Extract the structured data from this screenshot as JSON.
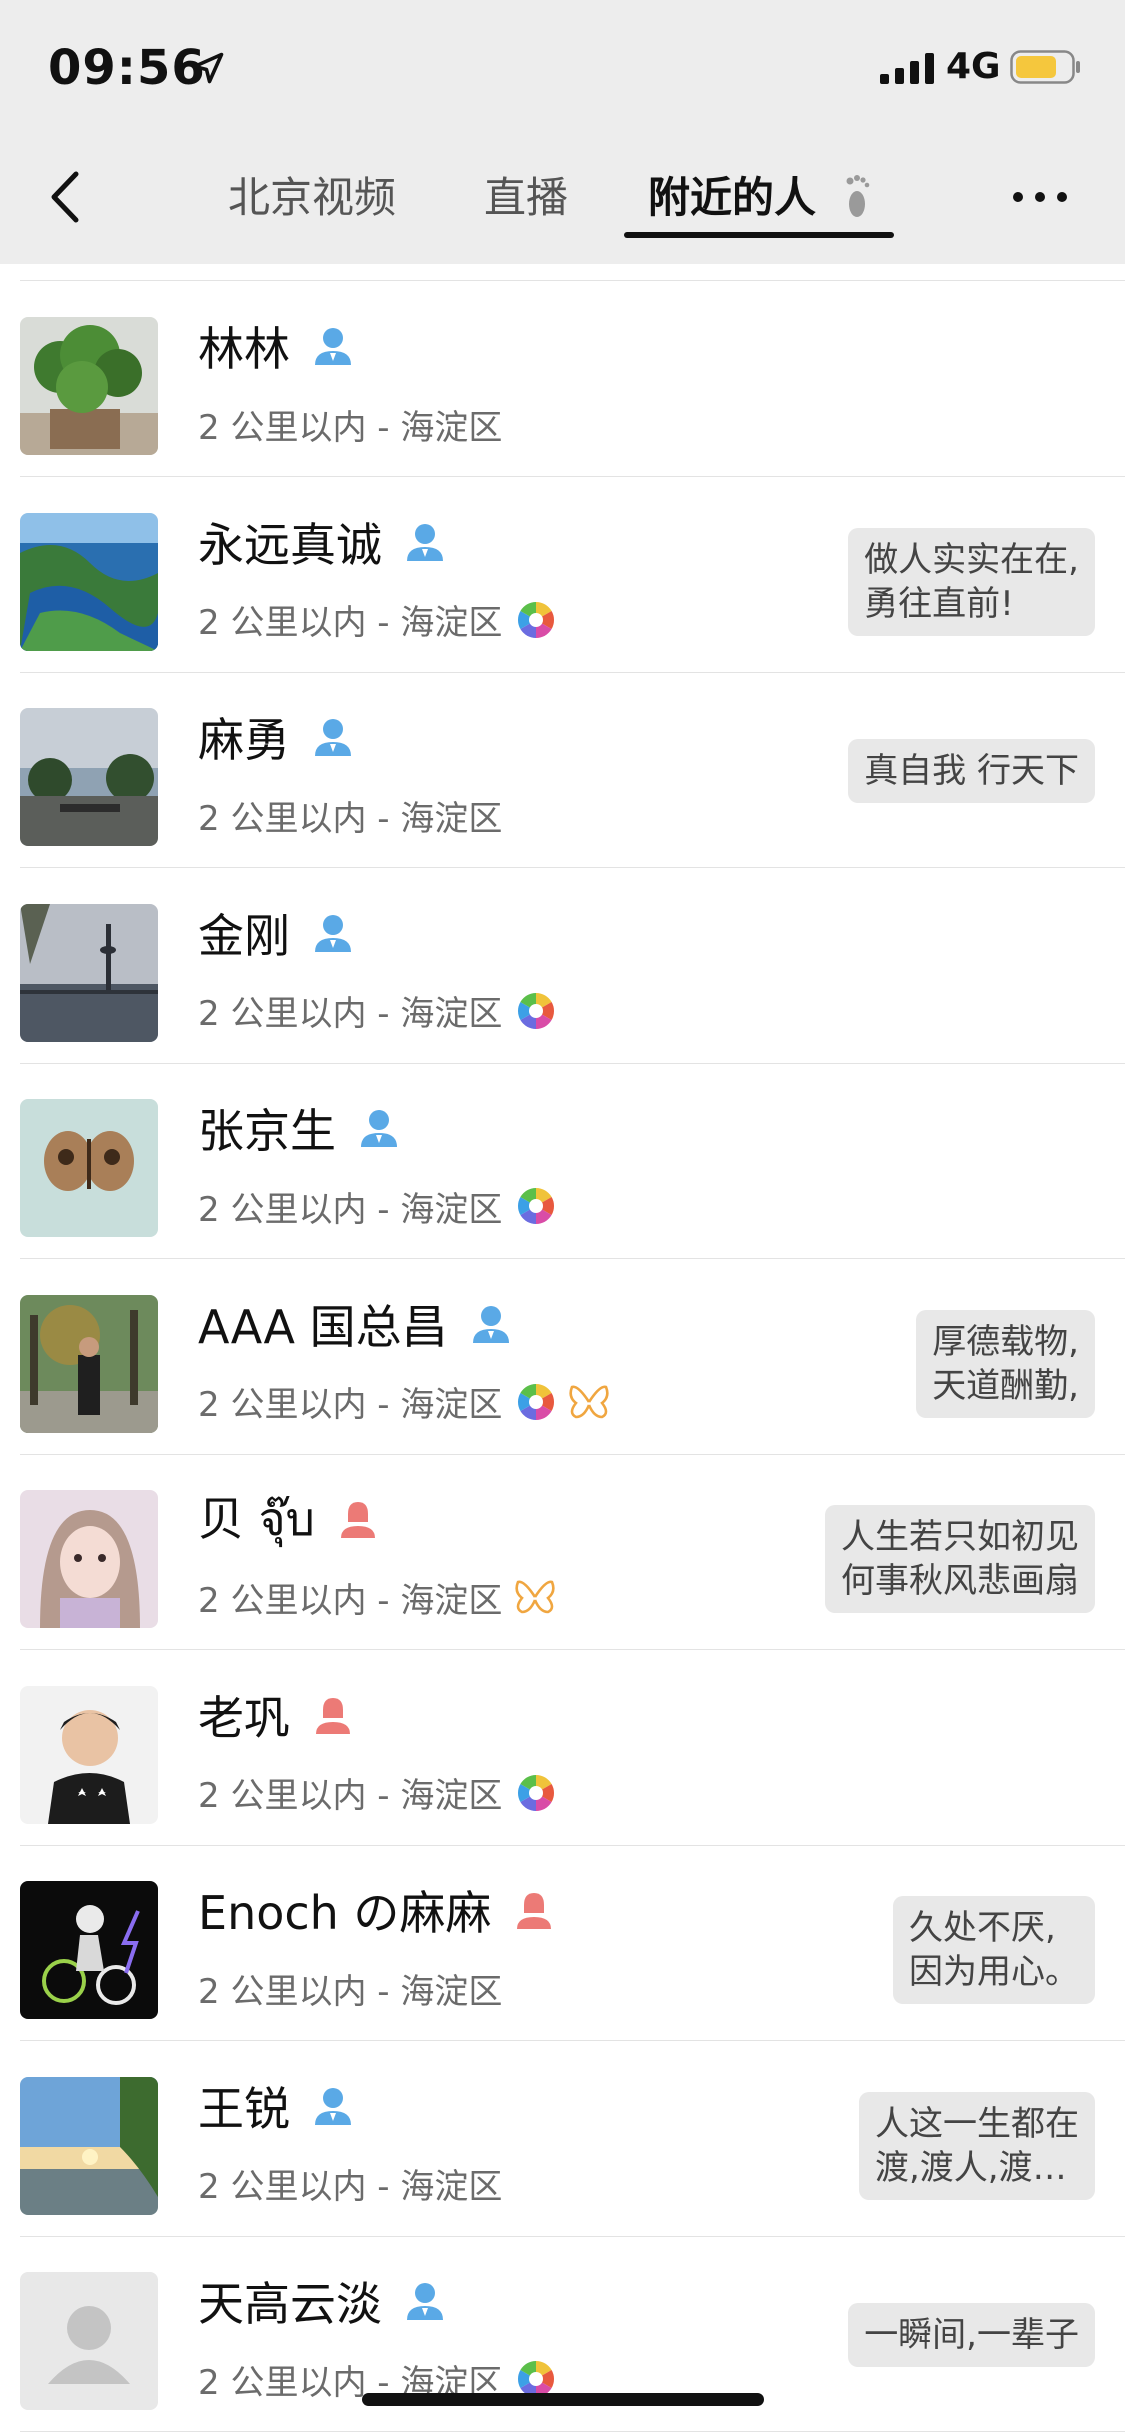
{
  "status_bar": {
    "time": "09:56",
    "network": "4G"
  },
  "nav": {
    "tabs": [
      {
        "label": "北京视频",
        "active": false
      },
      {
        "label": "直播",
        "active": false
      },
      {
        "label": "附近的人",
        "active": true
      }
    ]
  },
  "people": [
    {
      "name": "林林",
      "gender": "male",
      "distance": "2 公里以内 - 海淀区",
      "moments": false,
      "butterfly": false,
      "signature": "",
      "avatar": "plant"
    },
    {
      "name": "永远真诚",
      "gender": "male",
      "distance": "2 公里以内 - 海淀区",
      "moments": true,
      "butterfly": false,
      "signature": "做人实实在在,\n勇往直前!",
      "avatar": "coast"
    },
    {
      "name": "麻勇",
      "gender": "male",
      "distance": "2 公里以内 - 海淀区",
      "moments": false,
      "butterfly": false,
      "signature": "真自我 行天下",
      "avatar": "lake"
    },
    {
      "name": "金刚",
      "gender": "male",
      "distance": "2 公里以内 - 海淀区",
      "moments": true,
      "butterfly": false,
      "signature": "",
      "avatar": "tower"
    },
    {
      "name": "张京生",
      "gender": "male",
      "distance": "2 公里以内 - 海淀区",
      "moments": true,
      "butterfly": false,
      "signature": "",
      "avatar": "butterfly"
    },
    {
      "name": "AAA 国总昌",
      "gender": "male",
      "distance": "2 公里以内 - 海淀区",
      "moments": true,
      "butterfly": true,
      "signature": "厚德载物,\n天道酬勤,",
      "avatar": "park"
    },
    {
      "name": "贝 จุ๊บ",
      "gender": "female",
      "distance": "2 公里以内 - 海淀区",
      "moments": false,
      "butterfly": true,
      "signature": "人生若只如初见\n何事秋风悲画扇",
      "avatar": "girl"
    },
    {
      "name": "老巩",
      "gender": "female",
      "distance": "2 公里以内 - 海淀区",
      "moments": true,
      "butterfly": false,
      "signature": "",
      "avatar": "boy"
    },
    {
      "name": "Enoch の麻麻",
      "gender": "female",
      "distance": "2 公里以内 - 海淀区",
      "moments": false,
      "butterfly": false,
      "signature": "久处不厌,\n因为用心。",
      "avatar": "sketch"
    },
    {
      "name": "王锐",
      "gender": "male",
      "distance": "2 公里以内 - 海淀区",
      "moments": false,
      "butterfly": false,
      "signature": "人这一生都在\n渡,渡人,渡…",
      "avatar": "sunset"
    },
    {
      "name": "天高云淡",
      "gender": "male",
      "distance": "2 公里以内 - 海淀区",
      "moments": true,
      "butterfly": false,
      "signature": "一瞬间,一辈子",
      "avatar": "default"
    }
  ],
  "colors": {
    "header_bg": "#ededed",
    "male": "#5aa9e6",
    "female": "#ec7a76",
    "bubble_bg": "#e8e8e8",
    "battery": "#f5c73d"
  }
}
